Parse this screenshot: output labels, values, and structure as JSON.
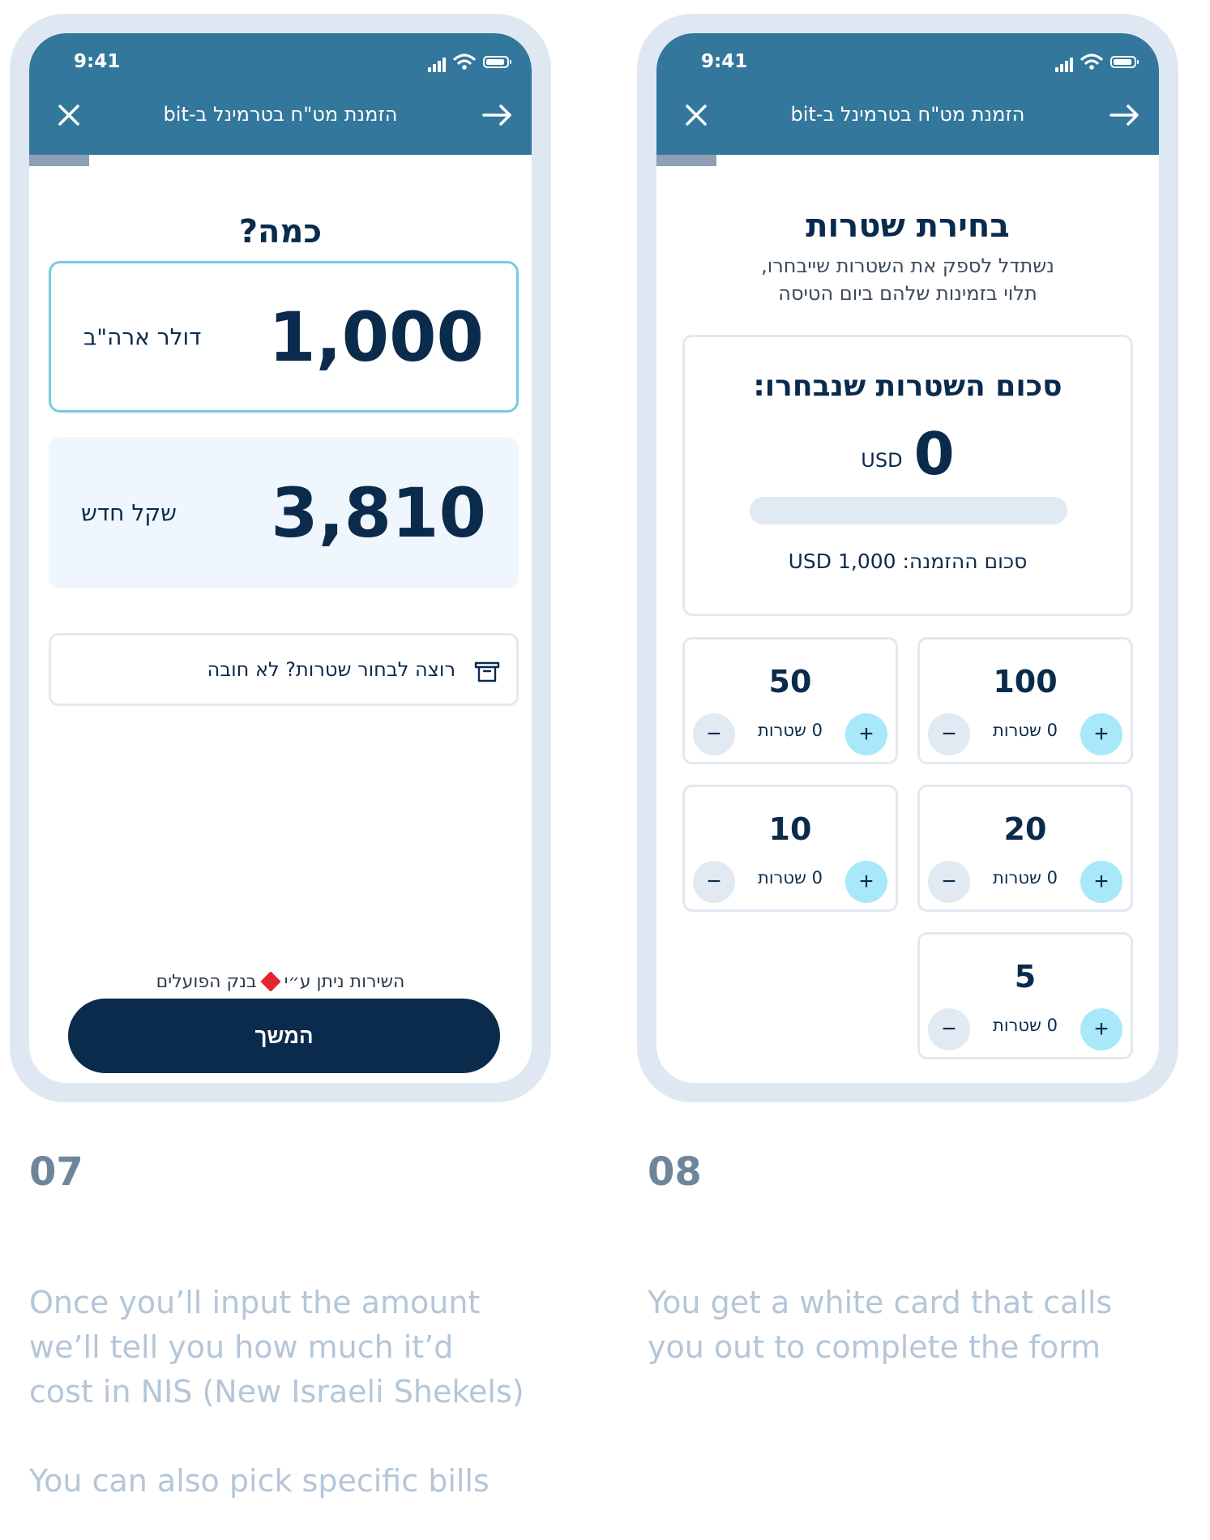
{
  "common": {
    "time": "9:41",
    "nav_title": "הזמנת מט\"ח בטרמינל ב-bit",
    "colors": {
      "header": "#33789c",
      "navy": "#0b2b4c",
      "accent": "#78cbe0"
    }
  },
  "screen1": {
    "heading": "כמה?",
    "usd_card": {
      "value": "1,000",
      "currency": "דולר ארה\"ב"
    },
    "nis_card": {
      "value": "3,810",
      "currency": "שקל חדש"
    },
    "bills_toggle": {
      "label": "רוצה לבחור שטרות? לא חובה",
      "icon": "banknote-icon"
    },
    "provider": {
      "prefix": "השירות ניתן ע״י",
      "bank": "בנק הפועלים"
    },
    "continue_label": "המשך",
    "progress": 0.88
  },
  "screen2": {
    "heading": "בחירת שטרות",
    "subtitle_line1": "נשתדל לספק את השטרות שייבחרו,",
    "subtitle_line2": "תלוי בזמינות שלהם ביום הטיסה",
    "summary": {
      "title": "סכום השטרות שנבחרו:",
      "value": "0",
      "currency": "USD",
      "order_label": "סכום ההזמנה: 1,000 USD"
    },
    "bills": [
      {
        "denomination": "100",
        "count": "0 שטרות"
      },
      {
        "denomination": "50",
        "count": "0 שטרות"
      },
      {
        "denomination": "20",
        "count": "0 שטרות"
      },
      {
        "denomination": "10",
        "count": "0 שטרות"
      },
      {
        "denomination": "5",
        "count": "0 שטרות"
      }
    ],
    "progress": 0.88
  },
  "steps": {
    "step7": {
      "number": "07",
      "caption_lines": [
        "Once you’ll input the amount",
        "we’ll tell you how much it’d",
        "cost in NIS (New Israeli Shekels)",
        "",
        "You can also pick specific bills"
      ]
    },
    "step8": {
      "number": "08",
      "caption_lines": [
        "You get a white card that calls",
        "you out to complete the form"
      ]
    }
  }
}
